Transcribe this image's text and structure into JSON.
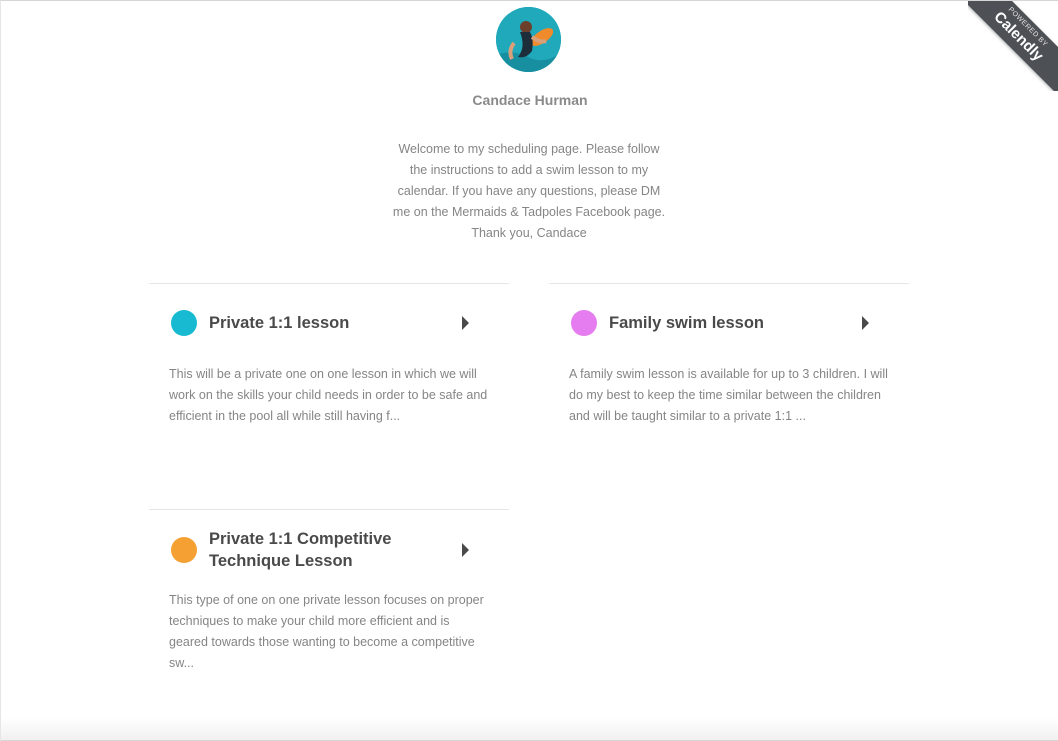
{
  "profile": {
    "name": "Candace Hurman",
    "avatar_icon": "profile-photo-swimmer",
    "welcome": "Welcome to my scheduling page. Please follow the instructions to add a swim lesson to my calendar. If you have any questions, please DM me on the Mermaids & Tadpoles Facebook page. Thank you, Candace"
  },
  "ribbon": {
    "small": "POWERED BY",
    "brand": "Calendly"
  },
  "events": [
    {
      "title": "Private 1:1 lesson",
      "color": "#17bad1",
      "description": "This will be a private one on one lesson in which we will work on the skills your child needs in order to be safe and efficient in the pool all while still having f..."
    },
    {
      "title": "Family swim lesson",
      "color": "#e57cf0",
      "description": "A family swim lesson is available for up to 3 children. I will do my best to keep the time similar between the children and will be taught similar to a private 1:1 ..."
    },
    {
      "title": "Private 1:1 Competitive Technique Lesson",
      "color": "#f5a033",
      "description": "This type of one on one private lesson focuses on proper techniques to make your child more efficient and is geared towards those wanting to become a competitive sw..."
    }
  ]
}
